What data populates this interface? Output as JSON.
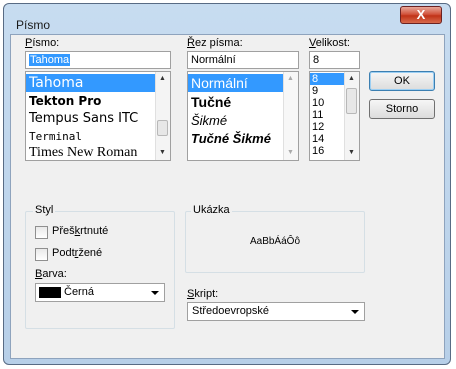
{
  "window": {
    "title": "Písmo",
    "close_glyph": "X"
  },
  "font": {
    "label_pre": "",
    "label_key": "P",
    "label_post": "ísmo:",
    "value": "Tahoma",
    "items": [
      "Tahoma",
      "Tekton Pro",
      "Tempus Sans ITC",
      "Terminal",
      "Times New Roman"
    ]
  },
  "style": {
    "label_pre": "",
    "label_key": "Ř",
    "label_post": "ez písma:",
    "value": "Normální",
    "items": [
      "Normální",
      "Tučné",
      "Šikmé",
      "Tučné Šikmé"
    ]
  },
  "size": {
    "label_pre": "",
    "label_key": "V",
    "label_post": "elikost:",
    "value": "8",
    "items": [
      "8",
      "9",
      "10",
      "11",
      "12",
      "14",
      "16"
    ]
  },
  "buttons": {
    "ok": "OK",
    "cancel": "Storno"
  },
  "effects": {
    "group_label": "Styl",
    "strikeout_pre": "Přeš",
    "strikeout_key": "k",
    "strikeout_post": "rtnuté",
    "underline_pre": "Podt",
    "underline_key": "r",
    "underline_post": "žené",
    "color_label_pre": "",
    "color_label_key": "B",
    "color_label_post": "arva:",
    "color_value": "Černá",
    "color_swatch": "#000000"
  },
  "sample": {
    "group_label": "Ukázka",
    "text": "AaBbÁáÔô"
  },
  "script": {
    "label_pre": "",
    "label_key": "S",
    "label_post": "kript:",
    "value": "Středoevropské"
  },
  "colors": {
    "selection": "#3399ff",
    "titlebar": "#c7dcf0",
    "close": "#c03318"
  }
}
